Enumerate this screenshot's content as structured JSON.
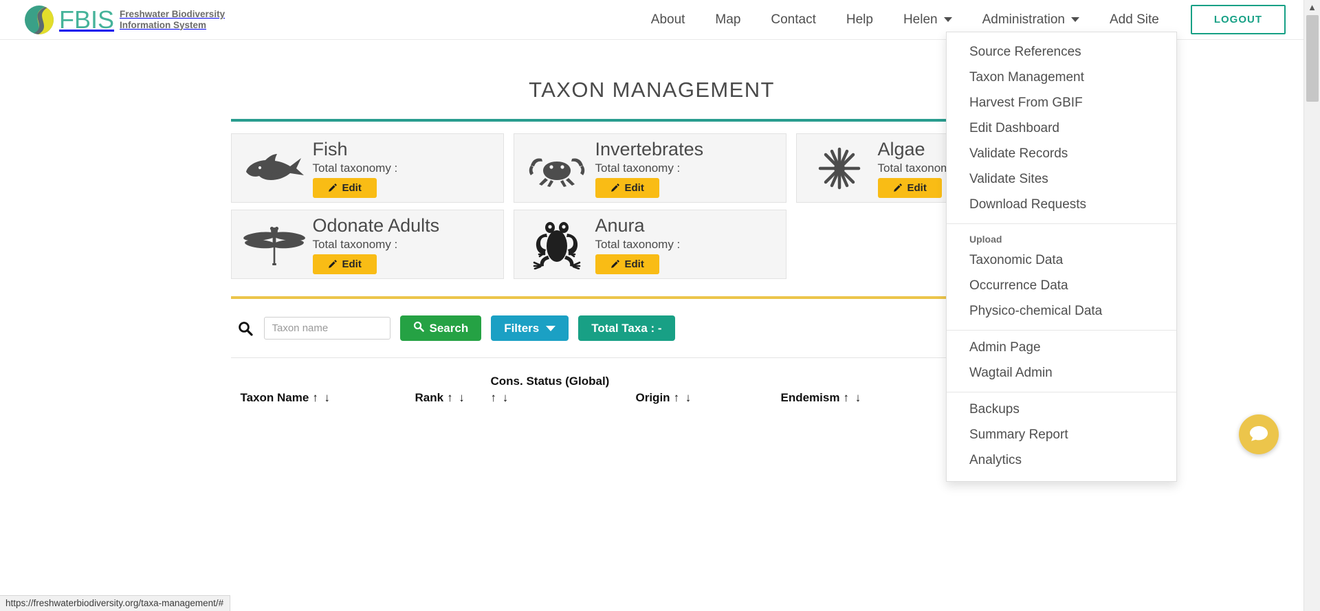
{
  "brand": {
    "wordmark": "FBIS",
    "line1": "Freshwater Biodiversity",
    "line2": "Information System"
  },
  "nav": {
    "links": [
      {
        "label": "About",
        "caret": false
      },
      {
        "label": "Map",
        "caret": false
      },
      {
        "label": "Contact",
        "caret": false
      },
      {
        "label": "Help",
        "caret": false
      },
      {
        "label": "Helen",
        "caret": true
      },
      {
        "label": "Administration",
        "caret": true
      },
      {
        "label": "Add Site",
        "caret": false
      }
    ],
    "logout_label": "LOGOUT"
  },
  "admin_menu": {
    "group1": [
      "Source References",
      "Taxon Management",
      "Harvest From GBIF",
      "Edit Dashboard",
      "Validate Records",
      "Validate Sites",
      "Download Requests"
    ],
    "upload_header": "Upload",
    "group2": [
      "Taxonomic Data",
      "Occurrence Data",
      "Physico-chemical Data"
    ],
    "group3": [
      "Admin Page",
      "Wagtail Admin"
    ],
    "group4": [
      "Backups",
      "Summary Report",
      "Analytics"
    ]
  },
  "main": {
    "title": "TAXON MANAGEMENT",
    "cards": [
      {
        "title": "Fish",
        "subtitle": "Total taxonomy :",
        "edit_label": "Edit",
        "icon": "fish-icon"
      },
      {
        "title": "Invertebrates",
        "subtitle": "Total taxonomy :",
        "edit_label": "Edit",
        "icon": "crab-icon"
      },
      {
        "title": "Algae",
        "subtitle": "Total taxonomy :",
        "edit_label": "Edit",
        "icon": "algae-icon"
      },
      {
        "title": "Odonate Adults",
        "subtitle": "Total taxonomy :",
        "edit_label": "Edit",
        "icon": "dragonfly-icon"
      },
      {
        "title": "Anura",
        "subtitle": "Total taxonomy :",
        "edit_label": "Edit",
        "icon": "frog-icon"
      }
    ]
  },
  "search": {
    "placeholder": "Taxon name",
    "value": "",
    "search_label": "Search",
    "filters_label": "Filters",
    "total_taxa_label": "Total Taxa : -"
  },
  "table": {
    "columns": [
      {
        "label": "Taxon Name",
        "arrows": "↑ ↓"
      },
      {
        "label": "Rank",
        "arrows": "↑ ↓"
      },
      {
        "label": "Cons. Status (Global)",
        "arrows": "↑ ↓"
      },
      {
        "label": "Origin",
        "arrows": "↑ ↓"
      },
      {
        "label": "Endemism",
        "arrows": "↑ ↓"
      }
    ],
    "rows": []
  },
  "status_bar": {
    "url": "https://freshwaterbiodiversity.org/taxa-management/#"
  },
  "colors": {
    "brand_teal": "#46b39a",
    "accent_teal": "#2a9d8f",
    "accent_amber": "#f9bc15",
    "rule_amber": "#ecc54b",
    "btn_green": "#25a244",
    "btn_blue": "#1ba0c4",
    "btn_total": "#18a085"
  }
}
